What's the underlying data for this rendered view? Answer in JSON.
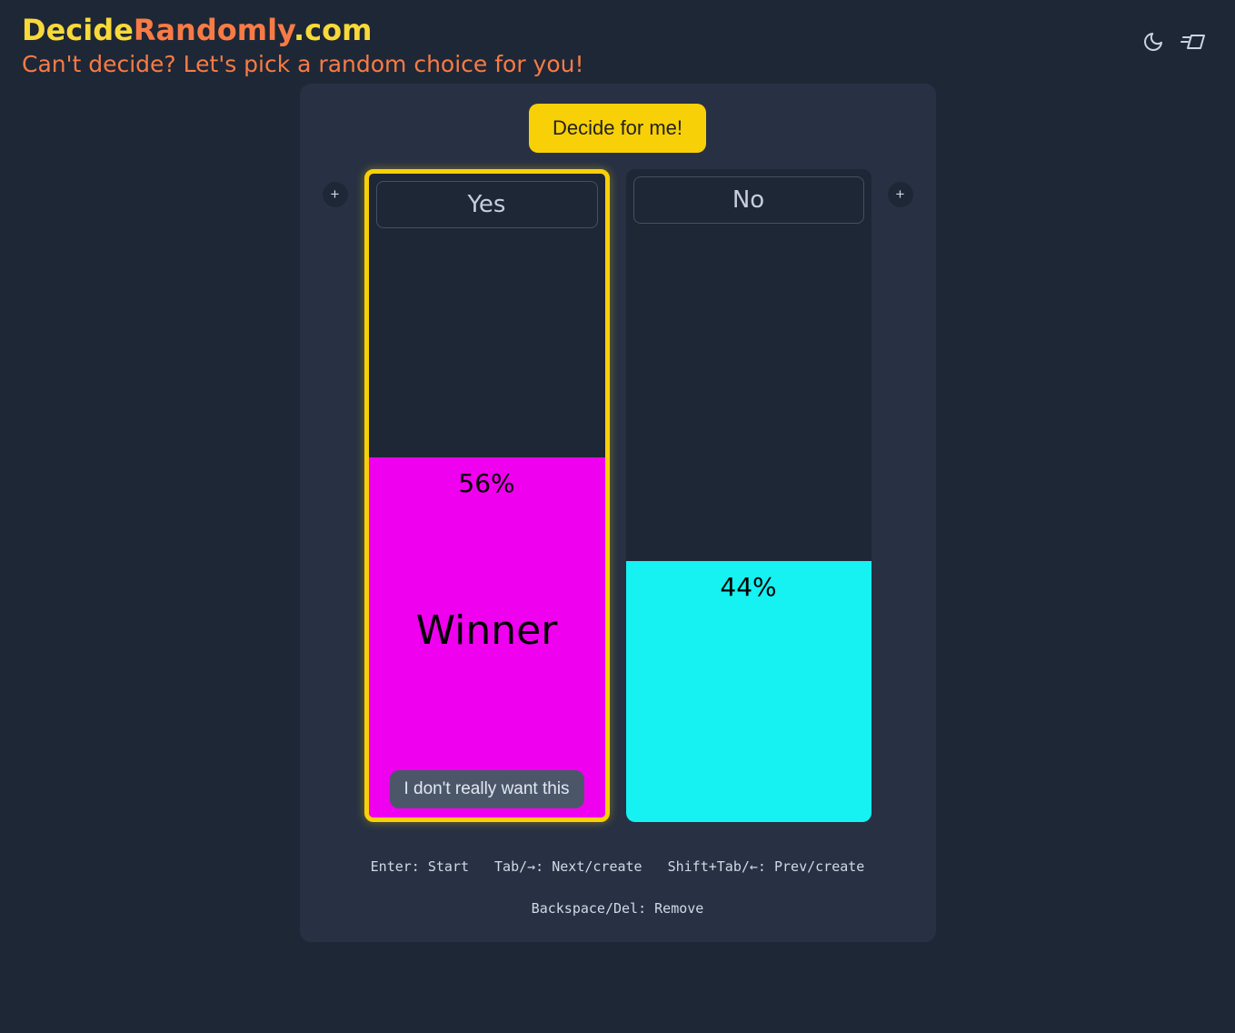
{
  "brand": {
    "part1": "Decide",
    "part2": "Randomly",
    "part3": ".com",
    "subtitle": "Can't decide? Let's pick a random choice for you!"
  },
  "decide_button": "Decide for me!",
  "add_button": "+",
  "cards": {
    "yes": {
      "label": "Yes",
      "percent": "56%",
      "winner_text": "Winner",
      "reject": "I don't really want this"
    },
    "no": {
      "label": "No",
      "percent": "44%"
    }
  },
  "hints": {
    "h1": "Enter: Start",
    "h2": "Tab/→: Next/create",
    "h3": "Shift+Tab/←: Prev/create",
    "h4": "Backspace/Del: Remove"
  }
}
